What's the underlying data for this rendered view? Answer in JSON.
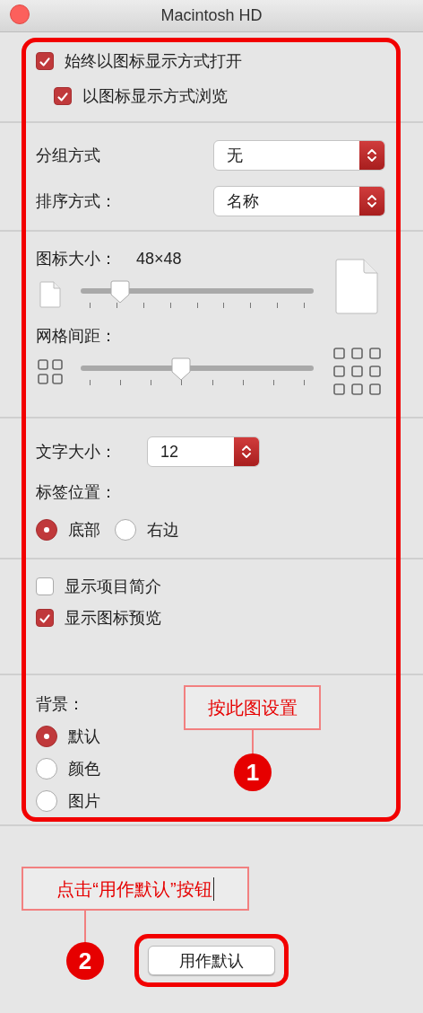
{
  "window": {
    "title": "Macintosh HD"
  },
  "open_options": [
    {
      "label": "始终以图标显示方式打开",
      "checked": true
    },
    {
      "label": "以图标显示方式浏览",
      "checked": true
    }
  ],
  "arrange": [
    {
      "label": "分组方式",
      "value": "无"
    },
    {
      "label": "排序方式：",
      "value": "名称"
    }
  ],
  "icon_size": {
    "label": "图标大小：",
    "reading": "48×48",
    "level": 0.17
  },
  "grid_spacing": {
    "label": "网格间距：",
    "level": 0.43
  },
  "text_size": {
    "label": "文字大小：",
    "value": "12"
  },
  "label_position": {
    "label": "标签位置：",
    "options": [
      {
        "label": "底部",
        "selected": true
      },
      {
        "label": "右边",
        "selected": false
      }
    ]
  },
  "show_options": [
    {
      "label": "显示项目简介",
      "checked": false
    },
    {
      "label": "显示图标预览",
      "checked": true
    }
  ],
  "background": {
    "label": "背景：",
    "options": [
      {
        "label": "默认",
        "selected": true
      },
      {
        "label": "颜色",
        "selected": false
      },
      {
        "label": "图片",
        "selected": false
      }
    ]
  },
  "annotations": [
    {
      "number": "1",
      "text": "按此图设置"
    },
    {
      "number": "2",
      "text": "点击“用作默认”按钮"
    }
  ],
  "default_button": "用作默认"
}
